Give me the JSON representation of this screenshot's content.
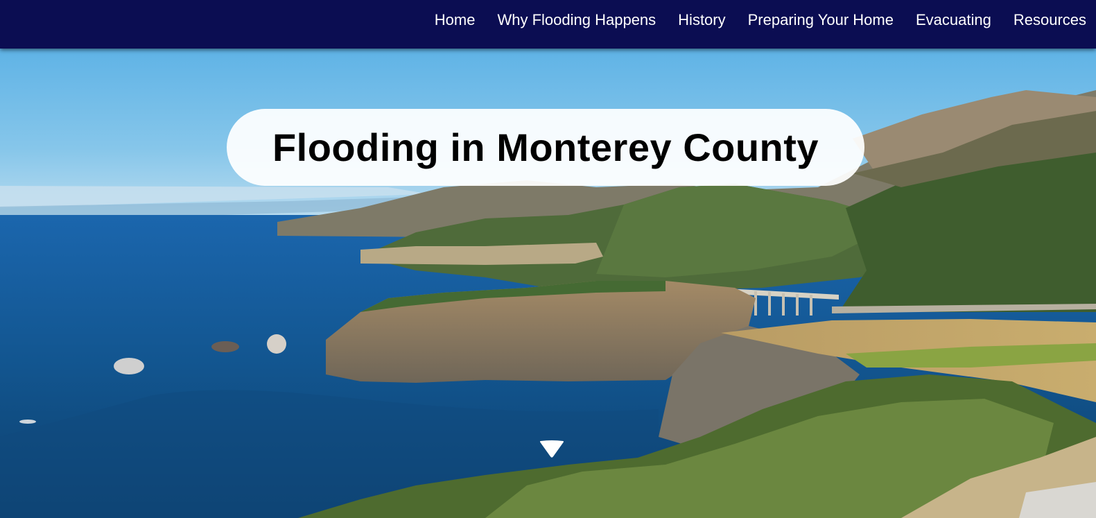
{
  "nav": {
    "items": [
      {
        "label": "Home"
      },
      {
        "label": "Why Flooding Happens"
      },
      {
        "label": "History"
      },
      {
        "label": "Preparing Your Home"
      },
      {
        "label": "Evacuating"
      },
      {
        "label": "Resources"
      }
    ]
  },
  "hero": {
    "title": "Flooding in Monterey County",
    "scroll_icon": "chevron-down-icon"
  },
  "colors": {
    "nav_background": "#0b0d52",
    "nav_text": "#ffffff",
    "title_background": "#ffffff",
    "title_text": "#000000"
  }
}
